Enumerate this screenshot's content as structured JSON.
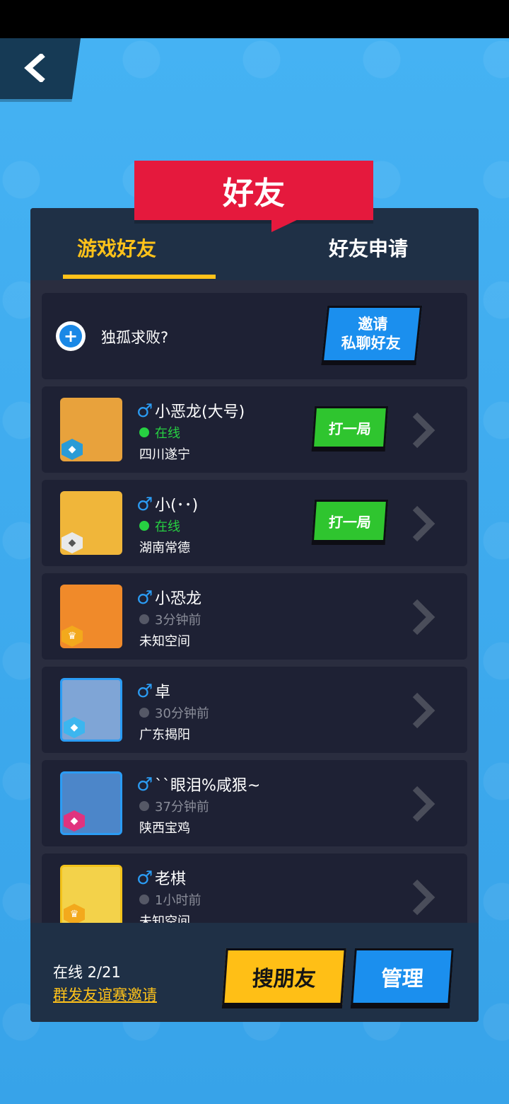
{
  "header": {
    "title": "好友"
  },
  "tabs": [
    {
      "label": "游戏好友",
      "active": true
    },
    {
      "label": "好友申请",
      "active": false
    }
  ],
  "invite": {
    "text": "独孤求败?",
    "button_line1": "邀请",
    "button_line2": "私聊好友"
  },
  "friends": [
    {
      "gender": "♂",
      "name": "小恶龙(大号)",
      "status": "在线",
      "online": true,
      "location": "四川遂宁",
      "action": "打一局",
      "avatar_color": "#e8a23c",
      "badge_color": "#2a9bd6"
    },
    {
      "gender": "♂",
      "name": "小(･･)",
      "status": "在线",
      "online": true,
      "location": "湖南常德",
      "action": "打一局",
      "avatar_color": "#f0b63a",
      "badge_color": "#e9e9e9"
    },
    {
      "gender": "♂",
      "name": "小恐龙",
      "status": "3分钟前",
      "online": false,
      "location": "未知空间",
      "action": "",
      "avatar_color": "#f08a2a",
      "badge_color": "#f3a91c"
    },
    {
      "gender": "♂",
      "name": "卓",
      "status": "30分钟前",
      "online": false,
      "location": "广东揭阳",
      "action": "",
      "avatar_color": "#7fa5d6",
      "badge_color": "#3cb6ef"
    },
    {
      "gender": "♂",
      "name": "``眼泪%咸狠~",
      "status": "37分钟前",
      "online": false,
      "location": "陕西宝鸡",
      "action": "",
      "avatar_color": "#4c86c9",
      "badge_color": "#e0337e"
    },
    {
      "gender": "♂",
      "name": "老棋",
      "status": "1小时前",
      "online": false,
      "location": "未知空间",
      "action": "",
      "avatar_color": "#f3d24a",
      "badge_color": "#f3a91c"
    }
  ],
  "footer": {
    "online_count": "在线 2/21",
    "group_invite": "群发友谊赛邀请",
    "search_button": "搜朋友",
    "manage_button": "管理"
  },
  "colors": {
    "background": "#3aa7ec",
    "panel": "#2a2d3f",
    "accent_yellow": "#ffc21a",
    "banner_red": "#e5193d",
    "online_green": "#27d142"
  }
}
